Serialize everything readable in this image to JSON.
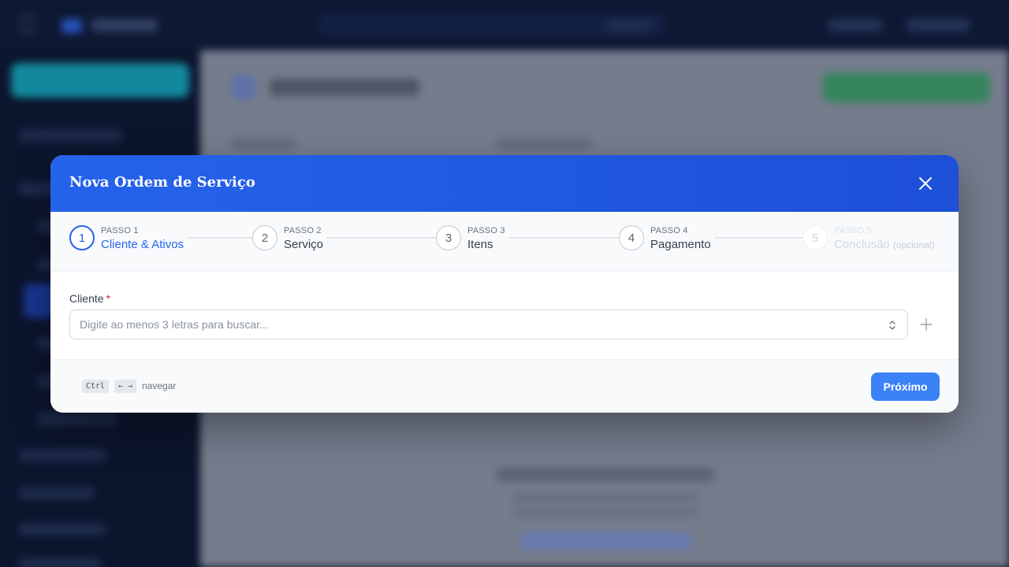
{
  "modal": {
    "title": "Nova Ordem de Serviço",
    "colors": {
      "header": "#2563eb",
      "accent": "#2563eb",
      "primary_button": "#3b82f6"
    }
  },
  "stepper": {
    "steps": [
      {
        "number": "1",
        "small": "PASSO 1",
        "label": "Cliente & Ativos",
        "state": "active"
      },
      {
        "number": "2",
        "small": "PASSO 2",
        "label": "Serviço",
        "state": "default"
      },
      {
        "number": "3",
        "small": "PASSO 3",
        "label": "Itens",
        "state": "default"
      },
      {
        "number": "4",
        "small": "PASSO 4",
        "label": "Pagamento",
        "state": "default"
      },
      {
        "number": "5",
        "small": "PASSO 5",
        "label": "Conclusão",
        "optional": "(opcional)",
        "state": "disabled"
      }
    ]
  },
  "form": {
    "client_label": "Cliente",
    "required_mark": "*",
    "client_placeholder": "Digite ao menos 3 letras para buscar...",
    "client_value": ""
  },
  "footer": {
    "shortcut_key1": "Ctrl",
    "shortcut_key2": "← →",
    "shortcut_hint": "navegar",
    "next_label": "Próximo"
  },
  "icons": {
    "close": "close-icon",
    "chevron": "chevron-up-down-icon",
    "add": "plus-icon"
  }
}
